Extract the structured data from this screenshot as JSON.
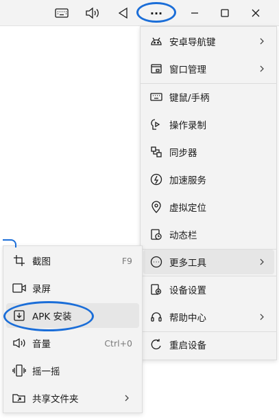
{
  "toolbar": {
    "icons": [
      "keyboard-icon",
      "volume-icon",
      "back-triangle-icon",
      "more-icon",
      "minimize-icon",
      "maximize-icon",
      "close-icon"
    ],
    "more_label": "···"
  },
  "main_menu": {
    "items": [
      {
        "label": "安卓导航键",
        "icon": "android-icon",
        "submenu": true
      },
      {
        "label": "窗口管理",
        "icon": "window-icon",
        "submenu": true
      },
      {
        "label": "键鼠/手柄",
        "icon": "keyboard-icon"
      },
      {
        "label": "操作录制",
        "icon": "record-icon"
      },
      {
        "label": "同步器",
        "icon": "sync-icon"
      },
      {
        "label": "加速服务",
        "icon": "lightning-icon"
      },
      {
        "label": "虚拟定位",
        "icon": "location-icon"
      },
      {
        "label": "动态栏",
        "icon": "dynamic-bar-icon"
      },
      {
        "label": "更多工具",
        "icon": "more-circle-icon",
        "submenu": true,
        "highlighted": true
      },
      {
        "label": "设备设置",
        "icon": "device-settings-icon"
      },
      {
        "label": "帮助中心",
        "icon": "help-icon",
        "submenu": true
      },
      {
        "label": "重启设备",
        "icon": "restart-icon"
      }
    ]
  },
  "sub_menu": {
    "items": [
      {
        "label": "截图",
        "shortcut": "F9",
        "icon": "crop-icon"
      },
      {
        "label": "录屏",
        "icon": "video-icon"
      },
      {
        "label": "APK 安装",
        "icon": "apk-install-icon",
        "highlighted": true
      },
      {
        "label": "音量",
        "shortcut": "Ctrl+0",
        "icon": "volume-icon"
      },
      {
        "label": "摇一摇",
        "icon": "shake-icon"
      },
      {
        "label": "共享文件夹",
        "icon": "share-folder-icon",
        "submenu": true
      }
    ]
  },
  "colors": {
    "annotation": "#1b6ed8",
    "menu_bg": "#f3f3f3",
    "highlight": "#e6e6e6"
  }
}
